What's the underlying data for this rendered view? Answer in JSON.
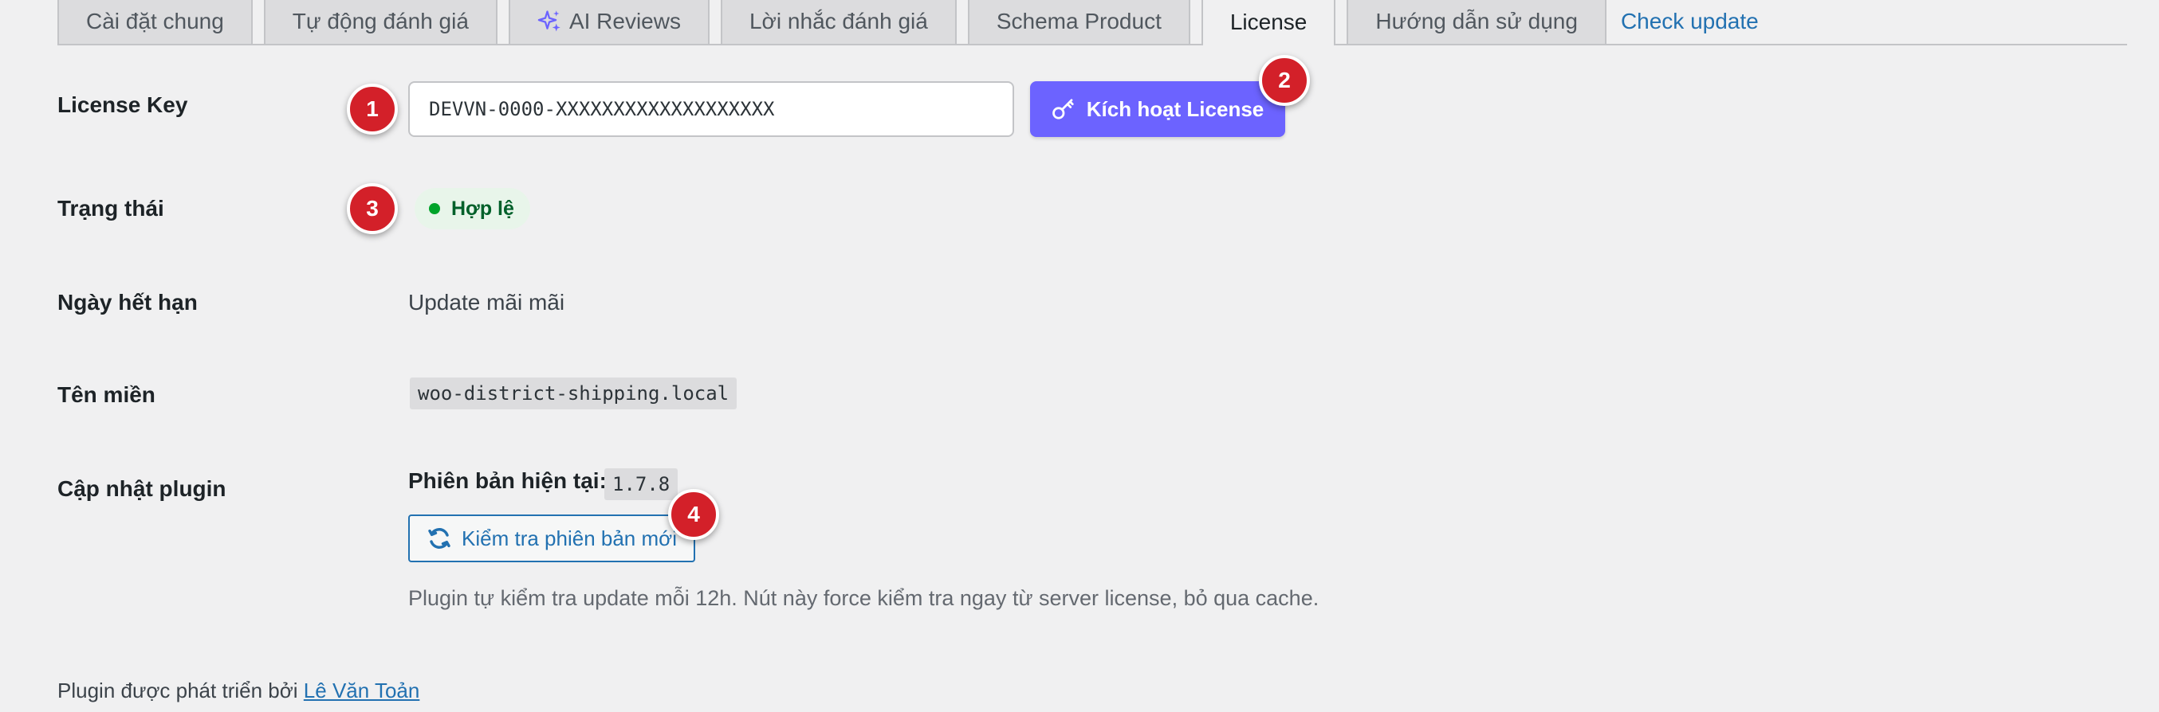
{
  "tabs": [
    {
      "label": "Cài đặt chung",
      "active": false
    },
    {
      "label": "Tự động đánh giá",
      "active": false
    },
    {
      "label": "AI Reviews",
      "active": false,
      "icon": "sparkle-icon"
    },
    {
      "label": "Lời nhắc đánh giá",
      "active": false
    },
    {
      "label": "Schema Product",
      "active": false
    },
    {
      "label": "License",
      "active": true
    },
    {
      "label": "Hướng dẫn sử dụng",
      "active": false
    }
  ],
  "check_update_link": "Check update",
  "license": {
    "label": "License Key",
    "value": "DEVVN-0000-XXXXXXXXXXXXXXXXXXX",
    "activate_button": "Kích hoạt License",
    "activate_icon": "key-icon"
  },
  "status": {
    "label": "Trạng thái",
    "value": "Hợp lệ",
    "color": "#00a32a"
  },
  "expiry": {
    "label": "Ngày hết hạn",
    "value": "Update mãi mãi"
  },
  "domain": {
    "label": "Tên miền",
    "value": "woo-district-shipping.local"
  },
  "plugin_update": {
    "label": "Cập nhật plugin",
    "version_label": "Phiên bản hiện tại:",
    "version": "1.7.8",
    "check_button": "Kiểm tra phiên bản mới",
    "check_icon": "refresh-icon",
    "help": "Plugin tự kiểm tra update mỗi 12h. Nút này force kiểm tra ngay từ server license, bỏ qua cache."
  },
  "footer": {
    "text": "Plugin được phát triển bởi",
    "author": "Lê Văn Toản"
  },
  "markers": [
    "1",
    "2",
    "3",
    "4"
  ],
  "colors": {
    "accent": "#6c63ff",
    "link": "#2271b1",
    "marker": "#d32029"
  }
}
